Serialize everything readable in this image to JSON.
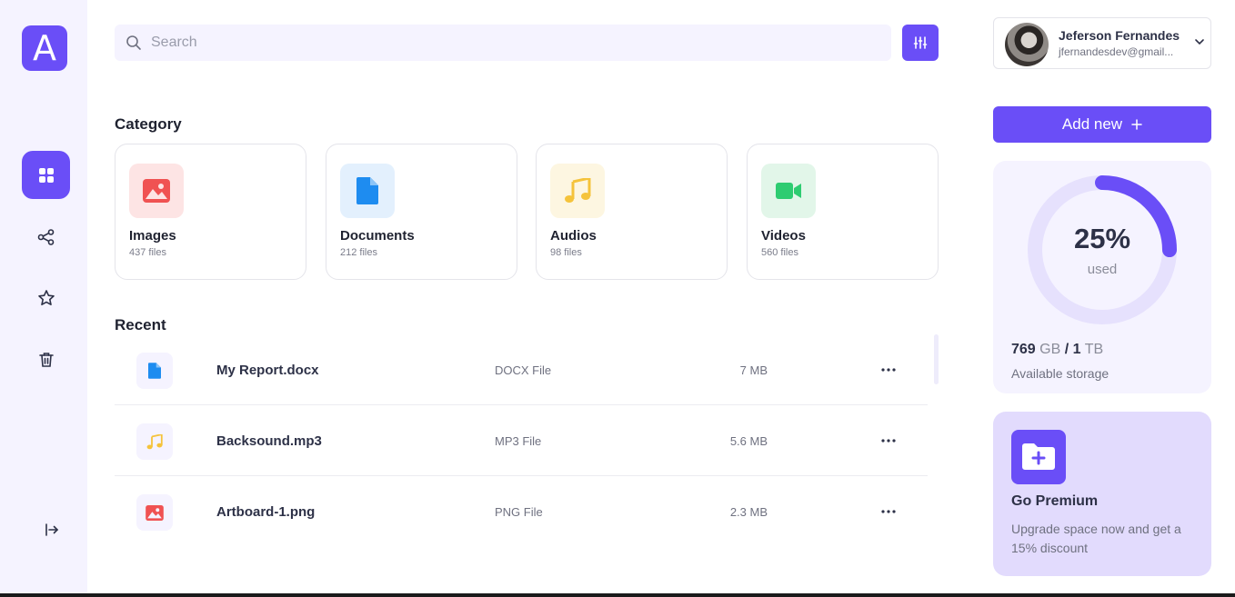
{
  "app": {
    "logo_letter": "A",
    "accent": "#6a4ef7"
  },
  "sidebar": {
    "items": [
      {
        "name": "dashboard",
        "icon": "grid-icon",
        "active": true
      },
      {
        "name": "share",
        "icon": "share-icon",
        "active": false
      },
      {
        "name": "favorites",
        "icon": "star-icon",
        "active": false
      },
      {
        "name": "trash",
        "icon": "trash-icon",
        "active": false
      }
    ],
    "logout_icon": "logout-icon"
  },
  "search": {
    "placeholder": "Search",
    "value": ""
  },
  "category": {
    "title": "Category",
    "items": [
      {
        "name": "Images",
        "count": "437 files",
        "icon": "image-icon",
        "bg": "#fde4e4",
        "color": "#f05252"
      },
      {
        "name": "Documents",
        "count": "212 files",
        "icon": "document-icon",
        "bg": "#e3f0fd",
        "color": "#1e8cf0"
      },
      {
        "name": "Audios",
        "count": "98 files",
        "icon": "music-note-icon",
        "bg": "#fdf6e1",
        "color": "#f5c33b"
      },
      {
        "name": "Videos",
        "count": "560 files",
        "icon": "video-camera-icon",
        "bg": "#e2f6e9",
        "color": "#2ecc71"
      }
    ]
  },
  "recent": {
    "title": "Recent",
    "files": [
      {
        "name": "My Report.docx",
        "type": "DOCX File",
        "size": "7 MB",
        "icon": "document-icon"
      },
      {
        "name": "Backsound.mp3",
        "type": "MP3 File",
        "size": "5.6 MB",
        "icon": "music-note-icon"
      },
      {
        "name": "Artboard-1.png",
        "type": "PNG File",
        "size": "2.3 MB",
        "icon": "image-icon"
      }
    ]
  },
  "profile": {
    "name": "Jeferson Fernandes",
    "email": "jfernandesdev@gmail..."
  },
  "add_button": {
    "label": "Add new",
    "icon": "plus-icon"
  },
  "storage": {
    "percent_label": "25%",
    "percent_value": 25,
    "used_label": "used",
    "used_amount": "769",
    "used_unit": "GB",
    "separator": "/",
    "total_amount": "1",
    "total_unit": "TB",
    "caption": "Available storage"
  },
  "premium": {
    "title": "Go Premium",
    "description": "Upgrade space now and get a 15% discount",
    "icon": "folder-plus-icon"
  }
}
